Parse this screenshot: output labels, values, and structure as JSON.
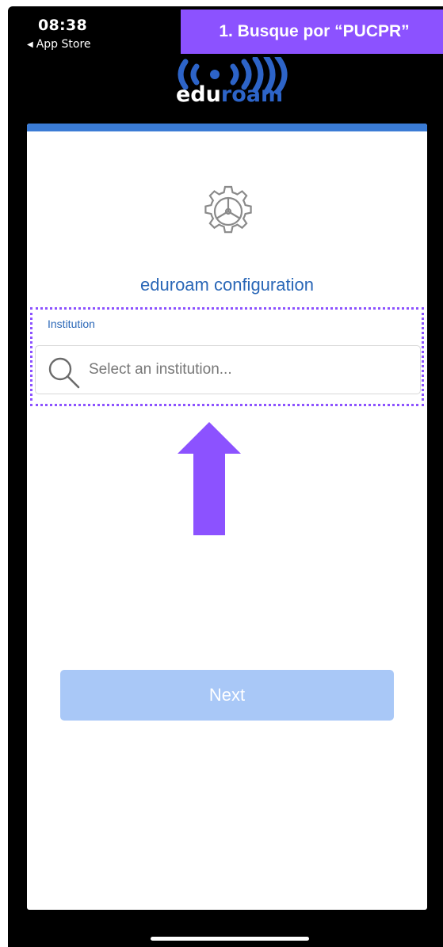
{
  "status_bar": {
    "time": "08:38",
    "back_label": "App Store",
    "back_glyph": "◀"
  },
  "logo": {
    "text_left": "edu",
    "text_right": "roam",
    "icon": "wifi-waves-icon"
  },
  "annotation": {
    "banner_text": "1. Busque por “PUCPR”",
    "accent_color": "#8c52ff",
    "arrow_icon": "arrow-up-icon"
  },
  "card": {
    "header_color": "#3a7bd5",
    "icon": "gear-icon",
    "title": "eduroam configuration",
    "institution_label": "Institution",
    "search_placeholder": "Select an institution...",
    "search_icon": "search-icon",
    "next_label": "Next",
    "next_color": "#a9c8f7"
  },
  "colors": {
    "title_blue": "#2a67b7",
    "logo_blue": "#2d64c8"
  }
}
